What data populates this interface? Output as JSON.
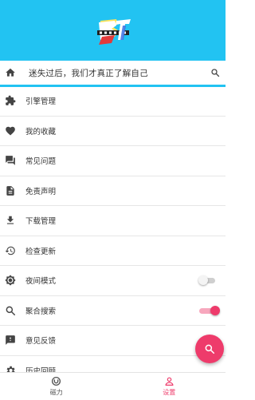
{
  "header": {
    "background": "#22c3f2",
    "logo": "BT"
  },
  "search_bar": {
    "quote": "迷失过后，我们才真正了解自己",
    "left_icon": "home-icon",
    "right_icon": "search-icon"
  },
  "menu": {
    "items": [
      {
        "label": "引擎管理",
        "icon": "puzzle-icon"
      },
      {
        "label": "我的收藏",
        "icon": "heart-icon"
      },
      {
        "label": "常见问题",
        "icon": "forum-icon"
      },
      {
        "label": "免责声明",
        "icon": "document-icon"
      },
      {
        "label": "下载管理",
        "icon": "download-icon"
      },
      {
        "label": "检查更新",
        "icon": "refresh-icon"
      },
      {
        "label": "夜间模式",
        "icon": "brightness-icon",
        "toggle": false
      },
      {
        "label": "聚合搜索",
        "icon": "search-icon",
        "toggle": true
      },
      {
        "label": "意见反馈",
        "icon": "feedback-icon"
      },
      {
        "label": "历史回顾",
        "icon": "gear-icon"
      }
    ]
  },
  "fab": {
    "icon": "search-icon",
    "color": "#ee3b6b"
  },
  "bottom_nav": {
    "tabs": [
      {
        "label": "磁力",
        "icon": "magnet-icon",
        "active": false
      },
      {
        "label": "设置",
        "icon": "person-icon",
        "active": true
      }
    ]
  },
  "colors": {
    "accent": "#ee3b6b",
    "primary": "#22c3f2"
  }
}
